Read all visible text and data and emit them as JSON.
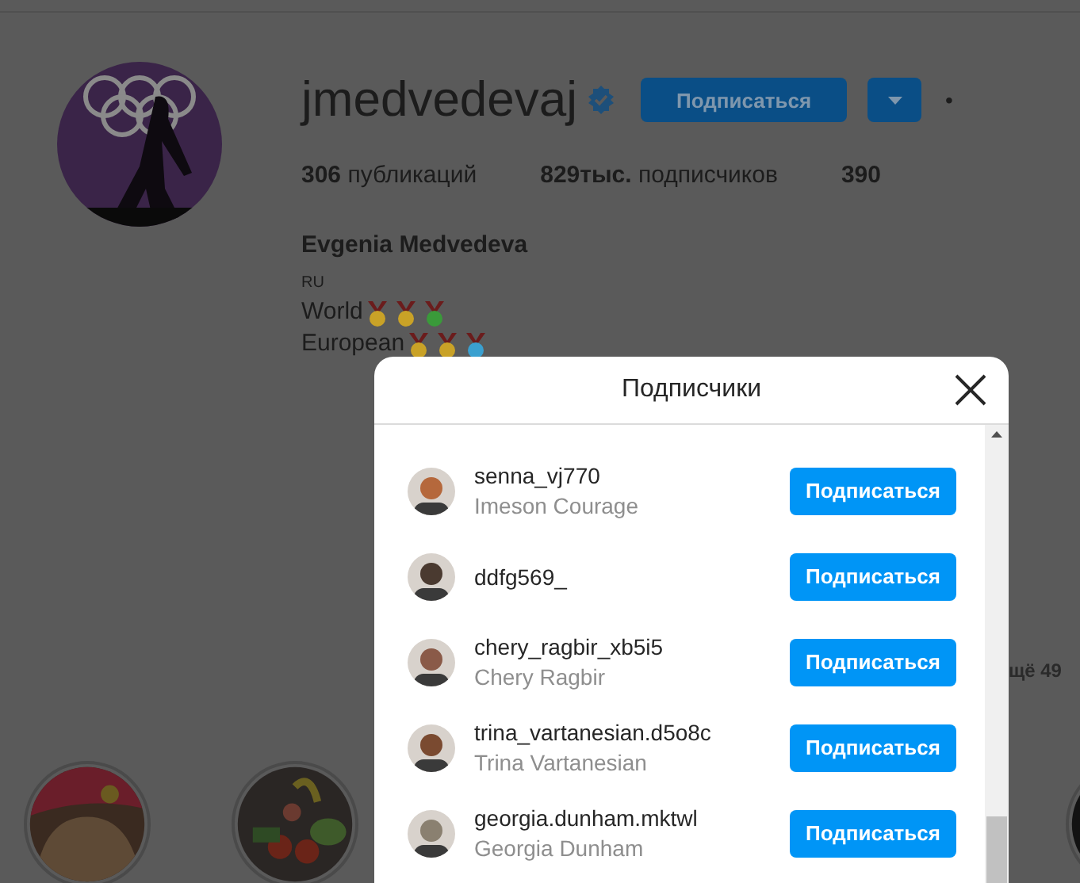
{
  "profile": {
    "username": "jmedvedevaj",
    "verified": true,
    "follow_button": "Подписаться",
    "more": "•",
    "stats": [
      {
        "value": "306",
        "label": "публикаций"
      },
      {
        "value": "829тыс.",
        "label": "подписчиков"
      },
      {
        "value": "390"
      }
    ],
    "full_name": "Evgenia Medvedeva",
    "country": "RU",
    "bio_lines": [
      {
        "text": "World",
        "medals": [
          {
            "color": "#c9a227"
          },
          {
            "color": "#c9a227"
          },
          {
            "color": "#3a9a3a"
          }
        ]
      },
      {
        "text": "European",
        "medals": [
          {
            "color": "#c9a227"
          },
          {
            "color": "#c9a227"
          },
          {
            "color": "#3aa0d0"
          }
        ]
      }
    ],
    "more_highlights": "щё 49"
  },
  "modal": {
    "title": "Подписчики",
    "followers": [
      {
        "username": "senna_vj770",
        "full_name": "Imeson Courage",
        "button": "Подписаться"
      },
      {
        "username": "ddfg569_",
        "button": "Подписаться"
      },
      {
        "username": "chery_ragbir_xb5i5",
        "full_name": "Chery Ragbir",
        "button": "Подписаться"
      },
      {
        "username": "trina_vartanesian.d5o8c",
        "full_name": "Trina Vartanesian",
        "button": "Подписаться"
      },
      {
        "username": "georgia.dunham.mktwl",
        "full_name": "Georgia Dunham",
        "button": "Подписаться"
      }
    ]
  }
}
